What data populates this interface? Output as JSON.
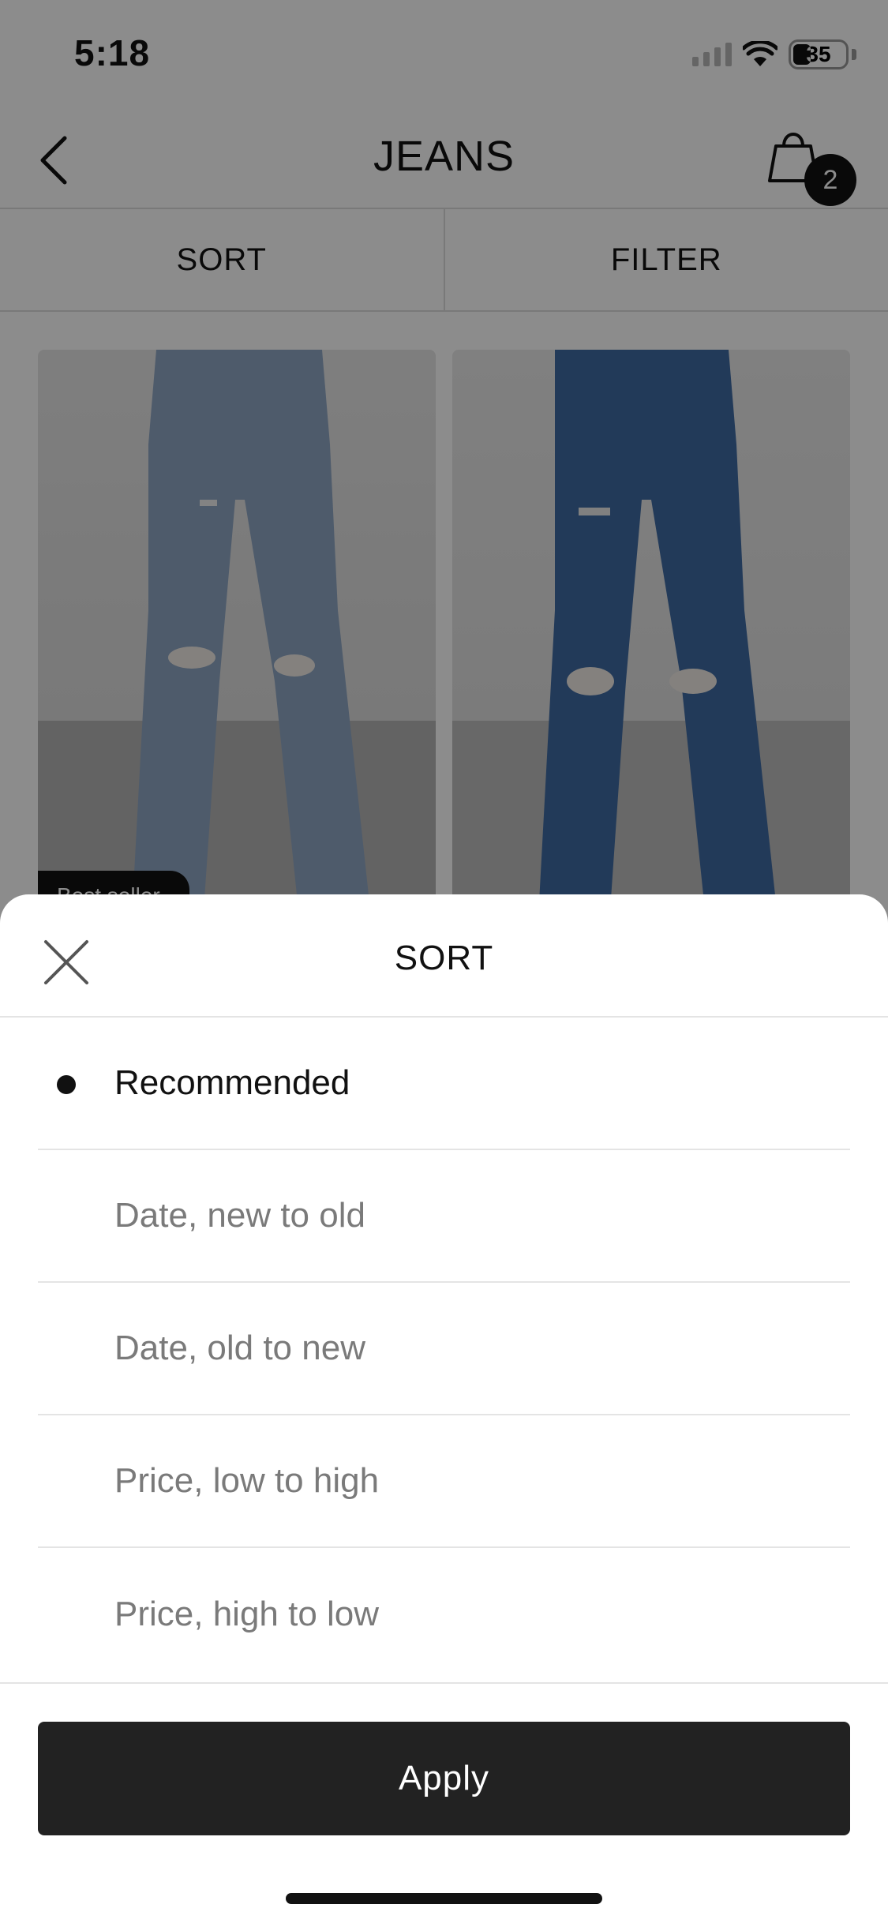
{
  "status_bar": {
    "time": "5:18",
    "battery": "35"
  },
  "header": {
    "title": "JEANS",
    "cart_count": "2"
  },
  "toolbar": {
    "sort_label": "SORT",
    "filter_label": "FILTER"
  },
  "products": [
    {
      "tag": "Best seller"
    },
    {
      "tag": ""
    }
  ],
  "sort_sheet": {
    "title": "SORT",
    "options": [
      {
        "label": "Recommended",
        "selected": true
      },
      {
        "label": "Date, new to old",
        "selected": false
      },
      {
        "label": "Date, old to new",
        "selected": false
      },
      {
        "label": "Price, low to high",
        "selected": false
      },
      {
        "label": "Price, high to low",
        "selected": false
      }
    ],
    "apply_label": "Apply"
  },
  "colors": {
    "overlay": "#000000",
    "button": "#222222",
    "selected_text": "#111111",
    "muted_text": "#7a7a7a"
  }
}
